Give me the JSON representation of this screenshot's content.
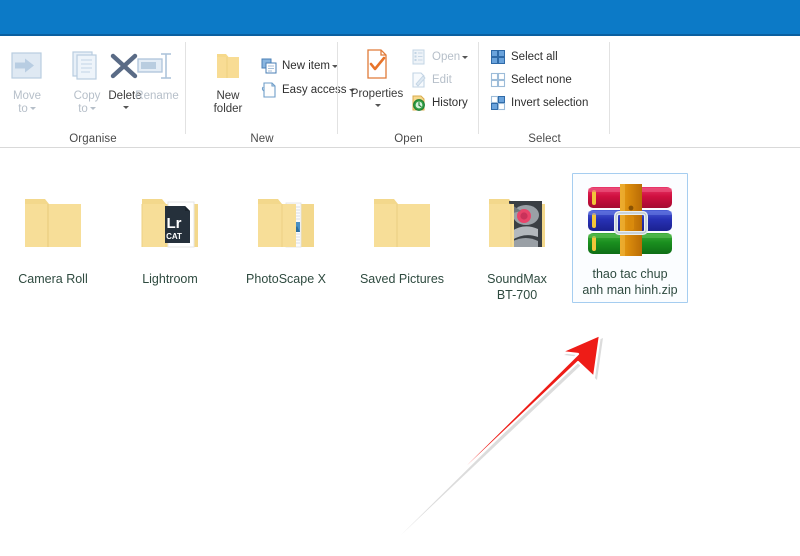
{
  "window": {
    "titlebar_color": "#0c7ac7"
  },
  "ribbon": {
    "groups": [
      {
        "name": "organise",
        "label": "Organise"
      },
      {
        "name": "new",
        "label": "New"
      },
      {
        "name": "open",
        "label": "Open"
      },
      {
        "name": "select",
        "label": "Select"
      }
    ],
    "organise": {
      "move_to": {
        "label": "Move\nto",
        "line1": "Move",
        "line2": "to",
        "icon": "move-to-icon",
        "disabled": true,
        "has_dropdown": true
      },
      "copy_to": {
        "label": "Copy\nto",
        "line1": "Copy",
        "line2": "to",
        "icon": "copy-to-icon",
        "disabled": true,
        "has_dropdown": true
      },
      "delete": {
        "label": "Delete",
        "icon": "delete-x-icon",
        "disabled": false,
        "has_dropdown": true
      },
      "rename": {
        "label": "Rename",
        "icon": "rename-icon",
        "disabled": true,
        "has_dropdown": false
      }
    },
    "new": {
      "new_folder": {
        "line1": "New",
        "line2": "folder",
        "icon": "new-folder-icon",
        "disabled": false
      },
      "new_item": {
        "label": "New item",
        "icon": "new-item-icon",
        "disabled": false,
        "has_dropdown": true
      },
      "easy_access": {
        "label": "Easy access",
        "icon": "easy-access-icon",
        "disabled": false,
        "has_dropdown": true
      }
    },
    "open": {
      "properties": {
        "label": "Properties",
        "icon": "properties-icon",
        "disabled": false,
        "has_dropdown": true
      },
      "open_item": {
        "label": "Open",
        "icon": "open-icon",
        "disabled": true,
        "has_dropdown": true
      },
      "edit": {
        "label": "Edit",
        "icon": "edit-icon",
        "disabled": true
      },
      "history": {
        "label": "History",
        "icon": "history-icon",
        "disabled": false
      }
    },
    "select": {
      "select_all": {
        "label": "Select all",
        "icon": "select-all-icon"
      },
      "select_none": {
        "label": "Select none",
        "icon": "select-none-icon"
      },
      "invert_selection": {
        "label": "Invert selection",
        "icon": "invert-selection-icon"
      }
    }
  },
  "content": {
    "items": [
      {
        "name": "camera-roll",
        "label": "Camera Roll",
        "type": "folder",
        "icon": "folder-plain-icon",
        "selected": false
      },
      {
        "name": "lightroom",
        "label": "Lightroom",
        "type": "folder",
        "icon": "folder-lightroom-icon",
        "badge": "Lr",
        "badge_sub": "CAT",
        "selected": false
      },
      {
        "name": "photoscape-x",
        "label": "PhotoScape X",
        "type": "folder",
        "icon": "folder-documents-icon",
        "selected": false
      },
      {
        "name": "saved-pictures",
        "label": "Saved Pictures",
        "type": "folder",
        "icon": "folder-plain-icon",
        "selected": false
      },
      {
        "name": "soundmax-bt-700",
        "label": "SoundMax BT-700",
        "label_line1": "SoundMax",
        "label_line2": "BT-700",
        "type": "folder",
        "icon": "folder-photo-icon",
        "selected": false
      },
      {
        "name": "thao-tac-chup-anh-man-hinh-zip",
        "label": "thao tac chup anh man hinh.zip",
        "label_line1": "thao tac chup",
        "label_line2": "anh man hinh.zip",
        "type": "archive",
        "icon": "winrar-archive-icon",
        "selected": true
      }
    ]
  },
  "annotation": {
    "arrow": {
      "name": "red-pointer-arrow",
      "color": "#ee1c17",
      "points_to": "thao-tac-chup-anh-man-hinh-zip"
    }
  }
}
